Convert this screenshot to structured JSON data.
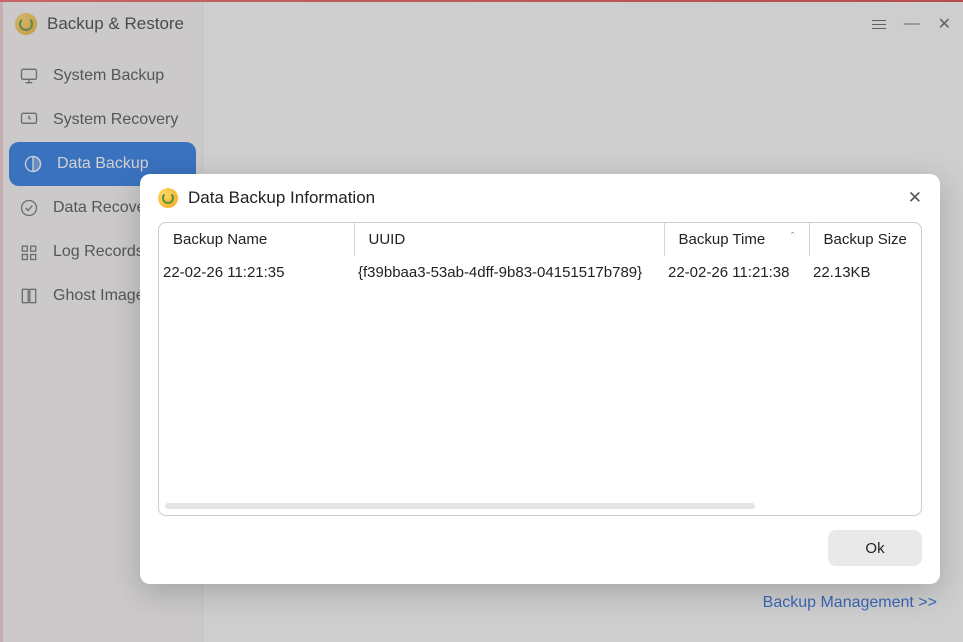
{
  "app": {
    "title": "Backup & Restore"
  },
  "sidebar": {
    "items": [
      {
        "label": "System Backup"
      },
      {
        "label": "System Recovery"
      },
      {
        "label": "Data Backup"
      },
      {
        "label": "Data Recovery"
      },
      {
        "label": "Log Records"
      },
      {
        "label": "Ghost Image"
      }
    ]
  },
  "dialog": {
    "title": "Data Backup Information",
    "headers": {
      "name": "Backup Name",
      "uuid": "UUID",
      "time": "Backup Time",
      "size": "Backup Size"
    },
    "rows": [
      {
        "name": "22-02-26 11:21:35",
        "uuid": "{f39bbaa3-53ab-4dff-9b83-04151517b789}",
        "time": "22-02-26 11:21:38",
        "size": "22.13KB"
      }
    ],
    "ok_label": "Ok"
  },
  "footer": {
    "link": "Backup Management >>"
  }
}
